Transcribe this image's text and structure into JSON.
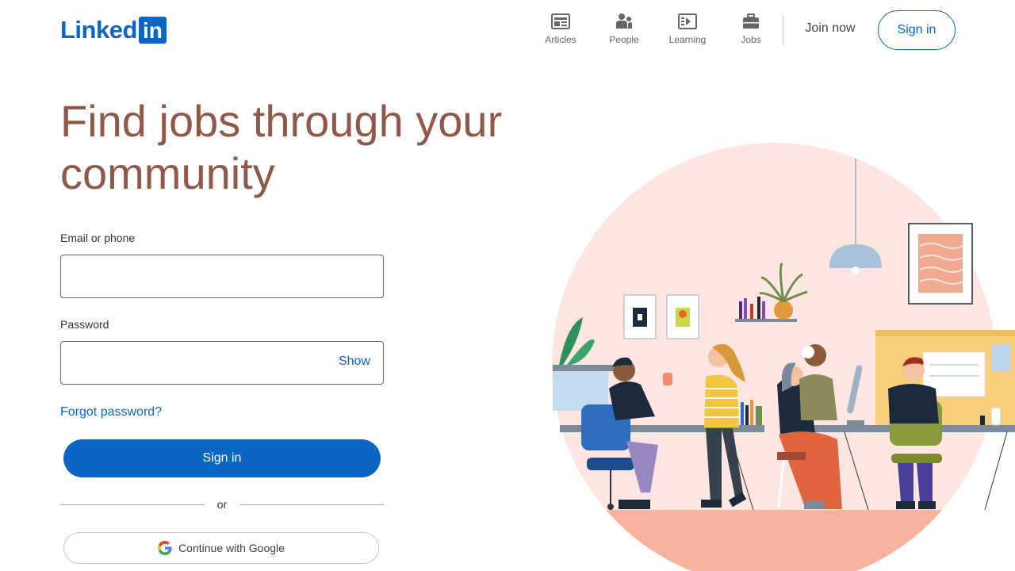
{
  "header": {
    "logo_text": "Linked",
    "logo_box_text": "in",
    "nav": [
      {
        "label": "Articles",
        "icon": "articles-icon"
      },
      {
        "label": "People",
        "icon": "people-icon"
      },
      {
        "label": "Learning",
        "icon": "learning-icon"
      },
      {
        "label": "Jobs",
        "icon": "jobs-icon"
      }
    ],
    "join_now": "Join now",
    "sign_in": "Sign in"
  },
  "hero": {
    "title": "Find jobs through your community"
  },
  "form": {
    "email_label": "Email or phone",
    "email_value": "",
    "password_label": "Password",
    "password_value": "",
    "show_label": "Show",
    "forgot_label": "Forgot password?",
    "sign_in_label": "Sign in",
    "or_label": "or",
    "google_label": "Continue with Google"
  },
  "colors": {
    "brand_blue": "#0a66c2",
    "hero_text": "#8f5849",
    "illustration_bg": "#fde6e1",
    "floor": "#f9b29d"
  }
}
